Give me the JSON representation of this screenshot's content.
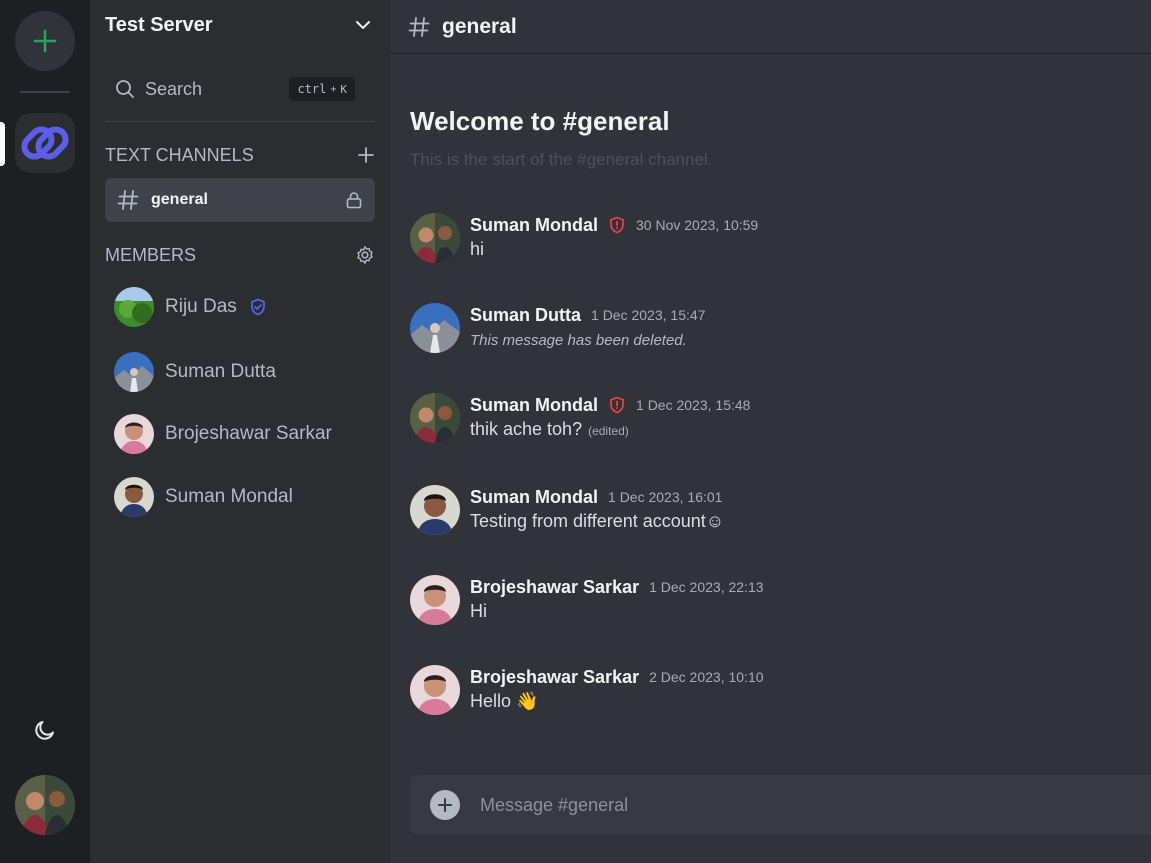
{
  "server": {
    "name": "Test Server",
    "search_label": "Search",
    "search_shortcut_key": "ctrl",
    "search_shortcut_plus": "+",
    "search_shortcut_letter": "K"
  },
  "sections": {
    "text_channels": "TEXT CHANNELS",
    "members": "MEMBERS"
  },
  "channels": [
    {
      "name": "general",
      "locked": true,
      "active": true
    }
  ],
  "members": [
    {
      "name": "Riju Das",
      "badge": "moderator-shield-icon"
    },
    {
      "name": "Suman Dutta"
    },
    {
      "name": "Brojeshawar Sarkar"
    },
    {
      "name": "Suman Mondal"
    }
  ],
  "chat": {
    "channel_name": "general",
    "welcome_title": "Welcome to #general",
    "welcome_subtitle": "This is the start of the #general channel.",
    "composer_placeholder": "Message #general",
    "messages": [
      {
        "author": "Suman Mondal",
        "badge": "admin-shield-icon",
        "time": "30 Nov 2023, 10:59",
        "text": "hi"
      },
      {
        "author": "Suman Dutta",
        "time": "1 Dec 2023, 15:47",
        "text": "This message has been deleted.",
        "deleted": true
      },
      {
        "author": "Suman Mondal",
        "badge": "admin-shield-icon",
        "time": "1 Dec 2023, 15:48",
        "text": "thik ache toh?",
        "edited": "(edited)"
      },
      {
        "author": "Suman Mondal",
        "time": "1 Dec 2023, 16:01",
        "text": "Testing from different account☺"
      },
      {
        "author": "Brojeshawar Sarkar",
        "time": "1 Dec 2023, 22:13",
        "text": "Hi"
      },
      {
        "author": "Brojeshawar Sarkar",
        "time": "2 Dec 2023, 10:10",
        "text": "Hello 👋"
      }
    ]
  },
  "colors": {
    "rail_bg": "#1e1f22",
    "sidebar_bg": "#2b2d31",
    "chat_bg": "#313338",
    "accent_green": "#23a55a",
    "moderator_badge": "#5865f2",
    "admin_badge": "#f23f43"
  }
}
